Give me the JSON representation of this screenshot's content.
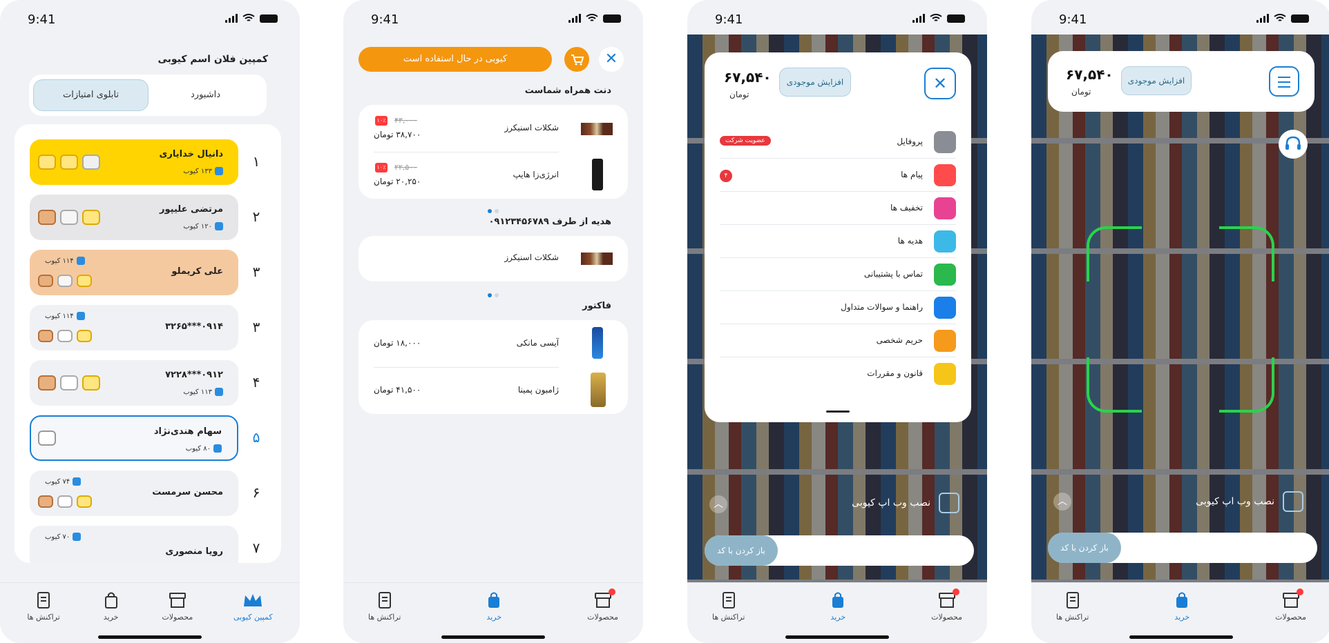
{
  "status": {
    "time": "9:41"
  },
  "nav": {
    "transactions": "تراکنش ها",
    "buy": "خرید",
    "products": "محصولات",
    "campaign": "کمپین کیوبی"
  },
  "leaderboard": {
    "title": "کمپین فلان اسم کیوبی",
    "tab_dashboard": "داشبورد",
    "tab_scores": "تابلوی امتیازات",
    "rows": [
      {
        "rank": "۱",
        "name": "دانیال خدایاری",
        "cubes": "۱۳۳ کیوب"
      },
      {
        "rank": "۲",
        "name": "مرتضی علیپور",
        "cubes": "۱۲۰ کیوب"
      },
      {
        "rank": "۳",
        "name": "علی کریملو",
        "cubes": "۱۱۴ کیوب"
      },
      {
        "rank": "۳",
        "name": "۰۹۱۴***۳۲۶۵",
        "cubes": "۱۱۴ کیوب"
      },
      {
        "rank": "۴",
        "name": "۰۹۱۲***۷۲۲۸",
        "cubes": "۱۱۳ کیوب"
      },
      {
        "rank": "۵",
        "name": "سهام هندی‌نژاد",
        "cubes": "۸۰ کیوب"
      },
      {
        "rank": "۶",
        "name": "محسن سرمست",
        "cubes": "۷۴ کیوب"
      },
      {
        "rank": "۷",
        "name": "رویا منصوری",
        "cubes": "۷۰ کیوب"
      }
    ]
  },
  "cart": {
    "banner": "کیوبی در حال استفاده است",
    "section_favorites": "دنت همراه شماست",
    "favorites": [
      {
        "name": "شکلات اسنیکرز",
        "old_price": "۴۳,۰۰۰",
        "price": "۳۸,۷۰۰ تومان",
        "discount": "۱۰٪"
      },
      {
        "name": "انرژی‌زا هایپ",
        "old_price": "۲۲,۵۰۰",
        "price": "۲۰,۲۵۰ تومان",
        "discount": "۱۰٪"
      }
    ],
    "section_gift": "هدیه از طرف ۰۹۱۲۳۴۵۶۷۸۹",
    "gift_item": "شکلات اسنیکرز",
    "section_invoice": "فاکتور",
    "invoice": [
      {
        "name": "آیسی مانکی",
        "price": "۱۸,۰۰۰ تومان"
      },
      {
        "name": "ژامبون پمینا",
        "price": "۴۱,۵۰۰ تومان"
      }
    ]
  },
  "wallet": {
    "amount": "۶۷,۵۴۰",
    "unit": "تومان",
    "increase": "افزایش موجودی"
  },
  "menu": {
    "items": [
      {
        "label": "پروفایل",
        "badge": "عضویت شرکت",
        "color": "#8a8d94"
      },
      {
        "label": "پیام ها",
        "count": "۴",
        "color": "#ff4b4b"
      },
      {
        "label": "تخفیف ها",
        "color": "#e84393"
      },
      {
        "label": "هدیه ها",
        "color": "#3cb9e6"
      },
      {
        "label": "تماس با پشتیبانی",
        "color": "#2bb84c"
      },
      {
        "label": "راهنما و سوالات متداول",
        "color": "#1a7fe8"
      },
      {
        "label": "حریم شخصی",
        "color": "#f59a1b"
      },
      {
        "label": "قانون و مقررات",
        "color": "#f5c518"
      }
    ]
  },
  "scan": {
    "install_pwa": "نصب وب اپ کیوبی",
    "open_with_code": "باز کردن با کد"
  }
}
